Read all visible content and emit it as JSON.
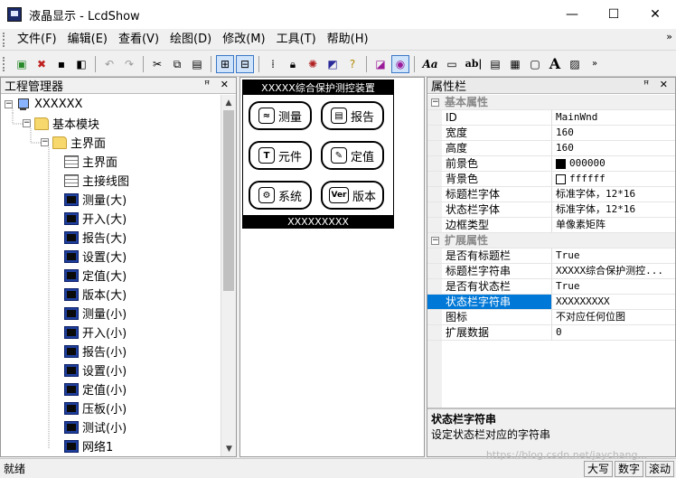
{
  "window": {
    "title": "液晶显示 - LcdShow",
    "controls": [
      "—",
      "☐",
      "✕"
    ]
  },
  "menu": [
    "文件(F)",
    "编辑(E)",
    "查看(V)",
    "绘图(D)",
    "修改(M)",
    "工具(T)",
    "帮助(H)"
  ],
  "menu_more": "»",
  "toolbar": {
    "text_aa": "Aa",
    "text_ab": "ab|",
    "text_a": "A"
  },
  "project": {
    "title": "工程管理器",
    "pane_controls": "ꟸ ✕",
    "root": "XXXXXX",
    "basic_module": "基本模块",
    "main_screen_folder": "主界面",
    "items": [
      {
        "label": "主界面",
        "icon": "grid"
      },
      {
        "label": "主接线图",
        "icon": "grid"
      },
      {
        "label": "测量(大)",
        "icon": "screen"
      },
      {
        "label": "开入(大)",
        "icon": "screen"
      },
      {
        "label": "报告(大)",
        "icon": "screen"
      },
      {
        "label": "设置(大)",
        "icon": "screen"
      },
      {
        "label": "定值(大)",
        "icon": "screen"
      },
      {
        "label": "版本(大)",
        "icon": "screen"
      },
      {
        "label": "测量(小)",
        "icon": "screen"
      },
      {
        "label": "开入(小)",
        "icon": "screen"
      },
      {
        "label": "报告(小)",
        "icon": "screen"
      },
      {
        "label": "设置(小)",
        "icon": "screen"
      },
      {
        "label": "定值(小)",
        "icon": "screen"
      },
      {
        "label": "压板(小)",
        "icon": "screen"
      },
      {
        "label": "测试(小)",
        "icon": "screen"
      },
      {
        "label": "网络1",
        "icon": "screen"
      }
    ]
  },
  "lcd": {
    "title": "XXXXX综合保护测控装置",
    "status": "XXXXXXXXX",
    "buttons": [
      {
        "label": "测量",
        "glyph": "≈"
      },
      {
        "label": "报告",
        "glyph": "▤"
      },
      {
        "label": "元件",
        "glyph": "T"
      },
      {
        "label": "定值",
        "glyph": "✎"
      },
      {
        "label": "系统",
        "glyph": "⚙"
      },
      {
        "label": "版本",
        "glyph": "Ver"
      }
    ]
  },
  "props": {
    "title": "属性栏",
    "pane_controls": "ꟸ ✕",
    "cat_basic": "基本属性",
    "basic": [
      {
        "key": "ID",
        "value": "MainWnd"
      },
      {
        "key": "宽度",
        "value": "160"
      },
      {
        "key": "高度",
        "value": "160"
      },
      {
        "key": "前景色",
        "value": "000000"
      },
      {
        "key": "背景色",
        "value": "ffffff"
      },
      {
        "key": "标题栏字体",
        "value": "标准字体，12*16"
      },
      {
        "key": "状态栏字体",
        "value": "标准字体，12*16"
      },
      {
        "key": "边框类型",
        "value": "单像素矩阵"
      }
    ],
    "cat_ext": "扩展属性",
    "ext": [
      {
        "key": "是否有标题栏",
        "value": "True"
      },
      {
        "key": "标题栏字符串",
        "value": "XXXXX综合保护测控..."
      },
      {
        "key": "是否有状态栏",
        "value": "True"
      },
      {
        "key": "状态栏字符串",
        "value": "XXXXXXXXX"
      },
      {
        "key": "图标",
        "value": "不对应任何位图"
      },
      {
        "key": "扩展数据",
        "value": "0"
      }
    ],
    "desc_title": "状态栏字符串",
    "desc_text": "设定状态栏对应的字符串"
  },
  "status": {
    "text": "就绪",
    "panes": [
      "大写",
      "数字",
      "滚动"
    ],
    "watermark": "https://blog.csdn.net/jaychang..."
  },
  "colors": {
    "selection": "#0078d7",
    "fg_swatch": "#000000",
    "bg_swatch": "#ffffff"
  }
}
